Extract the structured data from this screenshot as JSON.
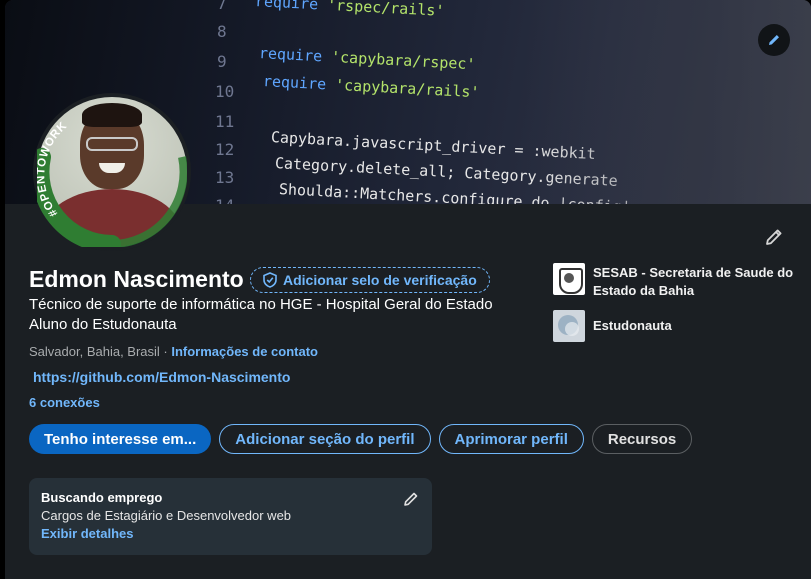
{
  "banner": {
    "line_numbers": [
      "7",
      "8",
      "9",
      "10",
      "11",
      "12",
      "13",
      "14"
    ],
    "code_lines": [
      {
        "kw": "require",
        "str": "'rspec/rails'"
      },
      {
        "kw": "require",
        "str": "'capybara/rspec'"
      },
      {
        "kw": "require",
        "str": "'capybara/rails'"
      },
      {
        "plain": "Capybara.javascript_driver = :webkit"
      },
      {
        "plain": "Category.delete_all; Category.generate"
      },
      {
        "plain": "Shoulda::Matchers.configure do |config|"
      }
    ]
  },
  "avatar": {
    "badge_text": "#OPENTOWORK"
  },
  "profile": {
    "name": "Edmon Nascimento",
    "verify_label": "Adicionar selo de verificação",
    "headline_line1": "Técnico de suporte de informática no HGE - Hospital Geral do Estado",
    "headline_line2": "Aluno do Estudonauta",
    "location": "Salvador, Bahia, Brasil",
    "location_sep": " · ",
    "contact_info": "Informações de contato",
    "website": "https://github.com/Edmon-Nascimento",
    "connections": "6 conexões"
  },
  "orgs": [
    {
      "name": "SESAB - Secretaria de Saude do Estado da Bahia"
    },
    {
      "name": "Estudonauta"
    }
  ],
  "buttons": {
    "open_to": "Tenho interesse em...",
    "add_section": "Adicionar seção do perfil",
    "enhance": "Aprimorar perfil",
    "resources": "Recursos"
  },
  "open_to_work_card": {
    "title": "Buscando emprego",
    "roles": "Cargos de Estagiário e Desenvolvedor web",
    "details": "Exibir detalhes"
  },
  "colors": {
    "accent": "#71b7fb",
    "primary_button": "#0a66c2",
    "card_bg": "#1b1f23",
    "otw_green": "#2f7d32"
  }
}
